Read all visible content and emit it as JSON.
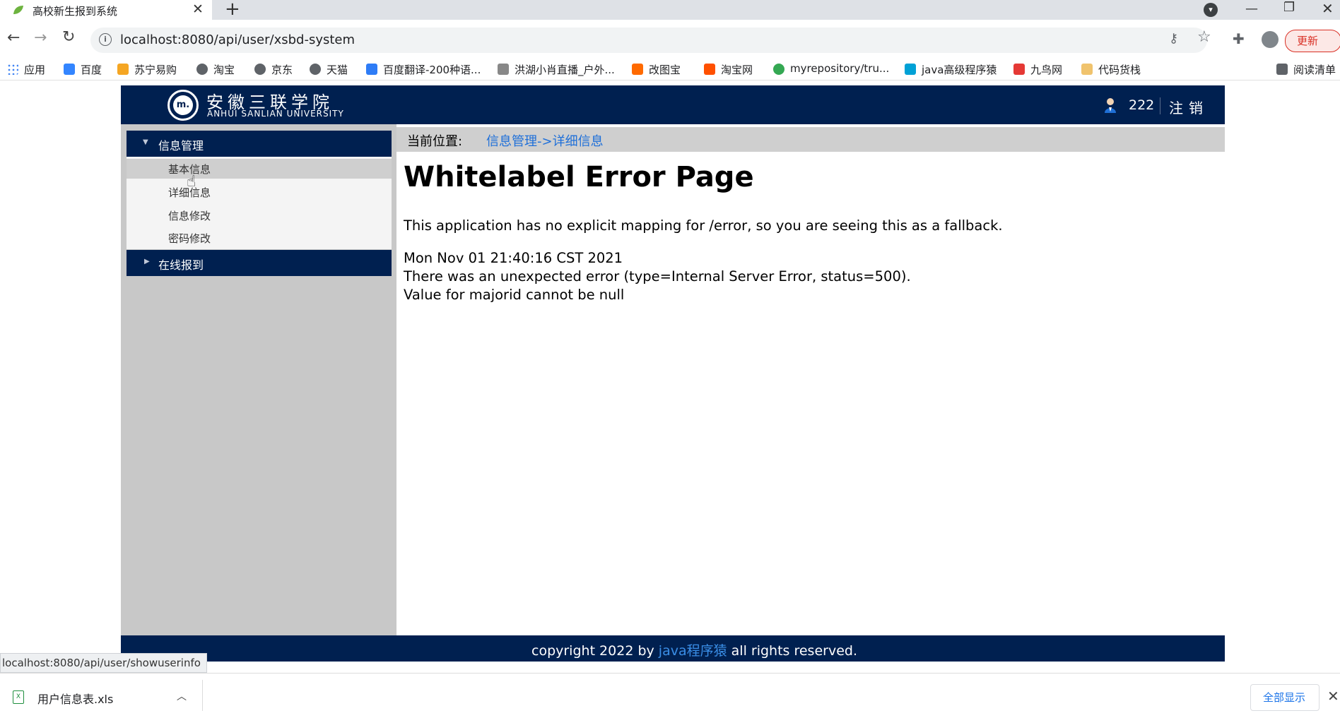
{
  "browser": {
    "tab_title": "高校新生报到系统",
    "tab_close": "✕",
    "new_tab": "+",
    "url": "localhost:8080/api/user/xsbd-system",
    "update_label": "更新",
    "bookmarks": [
      {
        "label": "应用",
        "color": "#4285f4"
      },
      {
        "label": "百度",
        "color": "#3385ff"
      },
      {
        "label": "苏宁易购",
        "color": "#f5a623"
      },
      {
        "label": "淘宝",
        "color": "#5f6368"
      },
      {
        "label": "京东",
        "color": "#5f6368"
      },
      {
        "label": "天猫",
        "color": "#5f6368"
      },
      {
        "label": "百度翻译-200种语...",
        "color": "#2e7cf6"
      },
      {
        "label": "洪湖小肖直播_户外...",
        "color": "#888888"
      },
      {
        "label": "改图宝",
        "color": "#ff6a00"
      },
      {
        "label": "淘宝网",
        "color": "#ff5000"
      },
      {
        "label": "myrepository/tru...",
        "color": "#34a853"
      },
      {
        "label": "java高级程序猿",
        "color": "#00a1d6"
      },
      {
        "label": "九鸟网",
        "color": "#e53935"
      },
      {
        "label": "代码货栈",
        "color": "#f0c36d"
      },
      {
        "label": "阅读清单",
        "color": "#5f6368"
      }
    ]
  },
  "header": {
    "logo_cn": "安徽三联学院",
    "logo_en": "ANHUI SANLIAN UNIVERSITY",
    "logo_mark": "m.",
    "username": "222",
    "logout": "注销"
  },
  "sidebar": {
    "menu1": {
      "label": "信息管理",
      "items": [
        "基本信息",
        "详细信息",
        "信息修改",
        "密码修改"
      ]
    },
    "menu2": {
      "label": "在线报到"
    }
  },
  "breadcrumb": {
    "label": "当前位置:",
    "value": "信息管理->详细信息"
  },
  "error": {
    "title": "Whitelabel Error Page",
    "line1": "This application has no explicit mapping for /error, so you are seeing this as a fallback.",
    "line2": "Mon Nov 01 21:40:16 CST 2021",
    "line3": "There was an unexpected error (type=Internal Server Error, status=500).",
    "line4": "Value for majorid cannot be null"
  },
  "footer": {
    "pre": "copyright 2022 by ",
    "link": "java程序猿",
    "post": " all rights reserved."
  },
  "status_url": "localhost:8080/api/user/showuserinfo",
  "downloads": {
    "file_name": "用户信息表.xls",
    "show_all": "全部显示"
  },
  "colors": {
    "header_bg": "#002050",
    "sidebar_bg": "#c8c8c8",
    "link_blue": "#1e6fd9",
    "update_red": "#d93025"
  }
}
